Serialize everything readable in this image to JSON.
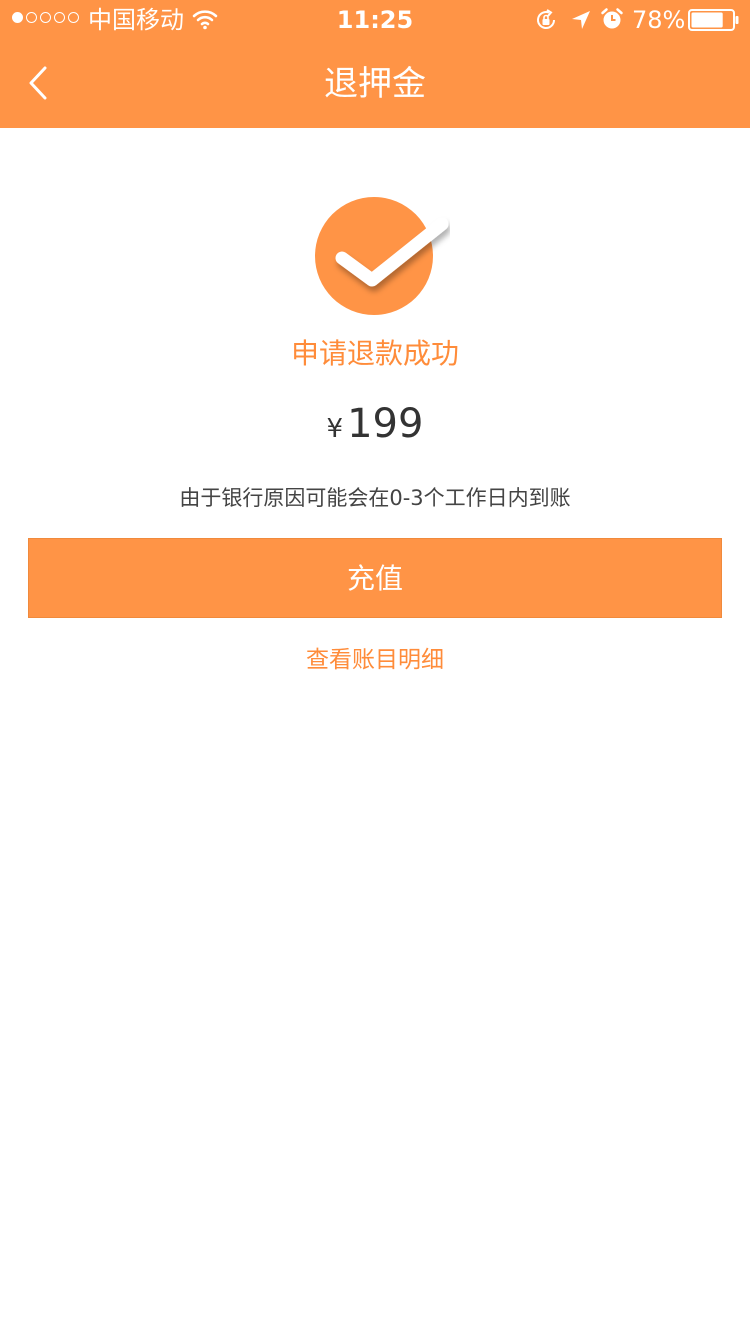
{
  "status_bar": {
    "carrier": "中国移动",
    "time": "11:25",
    "battery_percent": "78%",
    "battery_level": 0.78,
    "signal_strength": 1,
    "signal_max": 5,
    "icons": [
      "wifi-icon",
      "rotation-lock-icon",
      "location-icon",
      "alarm-icon",
      "battery-icon"
    ]
  },
  "nav": {
    "back_icon": "chevron-left-icon",
    "title": "退押金"
  },
  "result": {
    "icon": "checkmark-circle-icon",
    "status_text": "申请退款成功",
    "currency": "¥",
    "amount": "199",
    "notice": "由于银行原因可能会在0-3个工作日内到账"
  },
  "actions": {
    "recharge_label": "充值",
    "details_link": "查看账目明细"
  },
  "colors": {
    "accent": "#ff9446",
    "accent_text": "#ff8c3a",
    "text_dark": "#333333",
    "background": "#ffffff"
  }
}
